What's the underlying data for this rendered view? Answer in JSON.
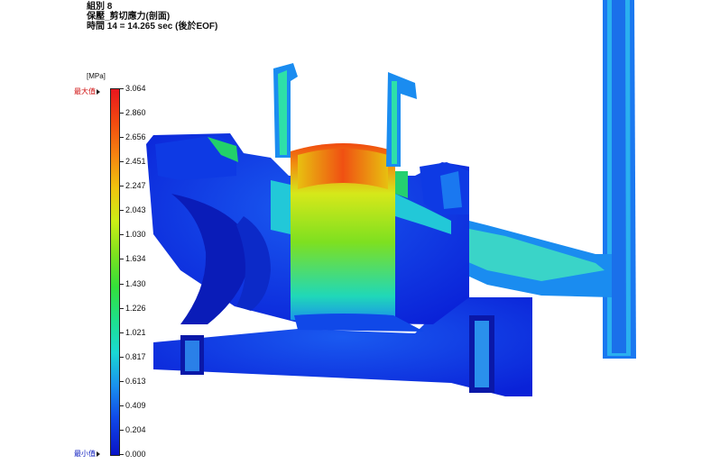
{
  "header": {
    "title": "組別 8",
    "result": "保壓_剪切應力(剖面)",
    "time": "時間 14 = 14.265 sec (後於EOF)"
  },
  "legend": {
    "unit": "[MPa]",
    "max_label": "最大值",
    "min_label": "最小值",
    "ticks": [
      "3.064",
      "2.860",
      "2.656",
      "2.451",
      "2.247",
      "2.043",
      "1.030",
      "1.634",
      "1.430",
      "1.226",
      "1.021",
      "0.817",
      "0.613",
      "0.409",
      "0.204",
      "0.000"
    ],
    "colors": {
      "max": "#e8161e",
      "min": "#0a14c8"
    }
  }
}
